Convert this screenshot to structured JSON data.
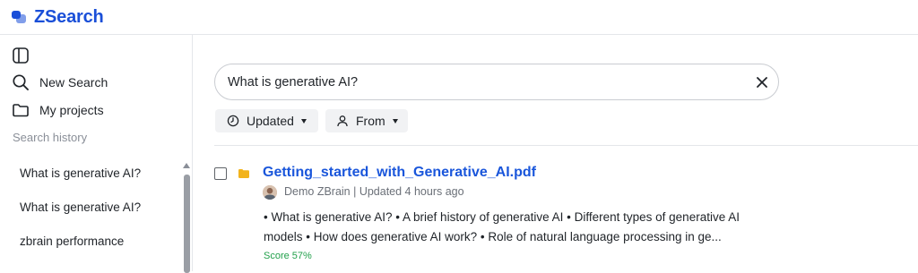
{
  "app": {
    "name": "ZSearch",
    "brand_color": "#1a4fd8",
    "logo_icon": "chat-bubbles-logo"
  },
  "sidebar": {
    "toggle_icon": "sidebar-toggle-icon",
    "new_search": "New Search",
    "my_projects": "My projects",
    "history_title": "Search history",
    "history": [
      "What is generative AI?",
      "What is generative AI?",
      "zbrain performance"
    ]
  },
  "search": {
    "query": "What is generative AI?",
    "clear_icon": "close-icon"
  },
  "filters": {
    "updated": "Updated",
    "from": "From"
  },
  "results": [
    {
      "title": "Getting_started_with_Generative_AI.pdf",
      "icon": "folder-icon",
      "meta": "Demo ZBrain | Updated 4 hours ago",
      "snippet_line1": "• What is generative AI? • A brief history of generative AI • Different types of generative AI",
      "snippet_line2": "models • How does generative AI work? • Role of natural language processing in ge...",
      "score": "Score 57%"
    }
  ],
  "colors": {
    "link": "#1a56db",
    "score": "#22a04b",
    "folder": "#f2b31c"
  }
}
